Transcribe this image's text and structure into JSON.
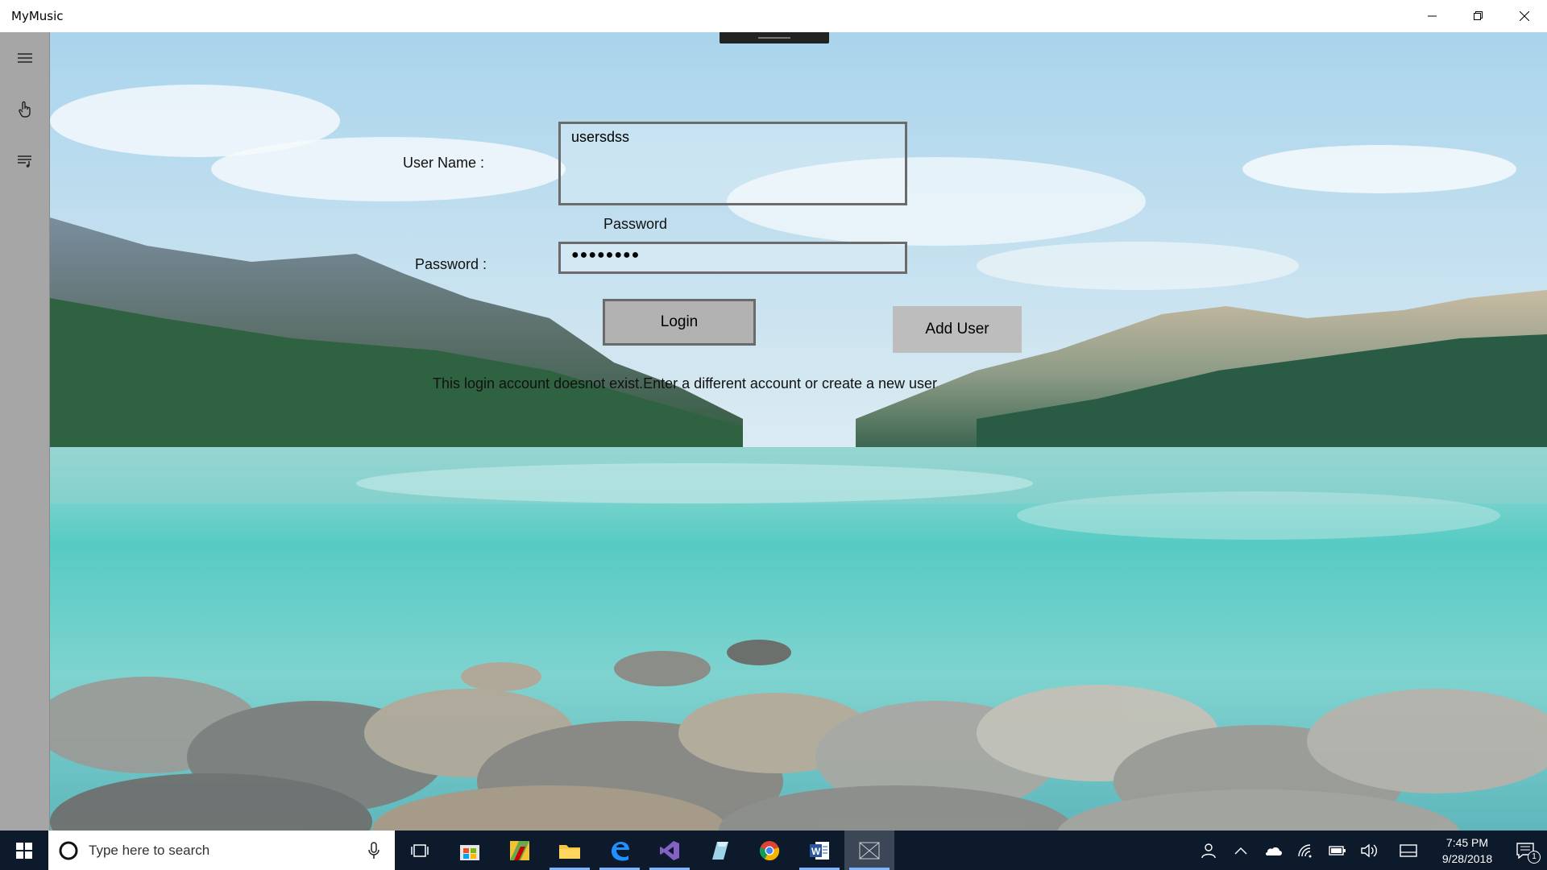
{
  "window": {
    "title": "MyMusic",
    "controls": [
      "minimize",
      "restore",
      "close"
    ]
  },
  "sidebar": {
    "items": [
      {
        "icon": "hamburger-menu-icon"
      },
      {
        "icon": "touch-hand-icon"
      },
      {
        "icon": "playlist-icon"
      }
    ]
  },
  "login": {
    "username_label": "User Name :",
    "username_value": "usersdss",
    "password_header": "Password",
    "password_label": "Password :",
    "password_value": "●●●●●●●●",
    "login_button": "Login",
    "add_user_button": "Add User",
    "error_message": "This login account doesnot exist.Enter a different account or create a new user"
  },
  "taskbar": {
    "search_placeholder": "Type here to search",
    "apps": [
      "task-view",
      "store",
      "paint",
      "file-explorer",
      "edge",
      "visual-studio",
      "blend",
      "chrome",
      "word",
      "mymusic"
    ],
    "time": "7:45 PM",
    "date": "9/28/2018",
    "notification_count": "1"
  },
  "colors": {
    "sidebar": "#a6a6a6",
    "taskbar": "#0d1a2b",
    "lake": "#4fc8c0",
    "sky": "#b8dcef"
  }
}
